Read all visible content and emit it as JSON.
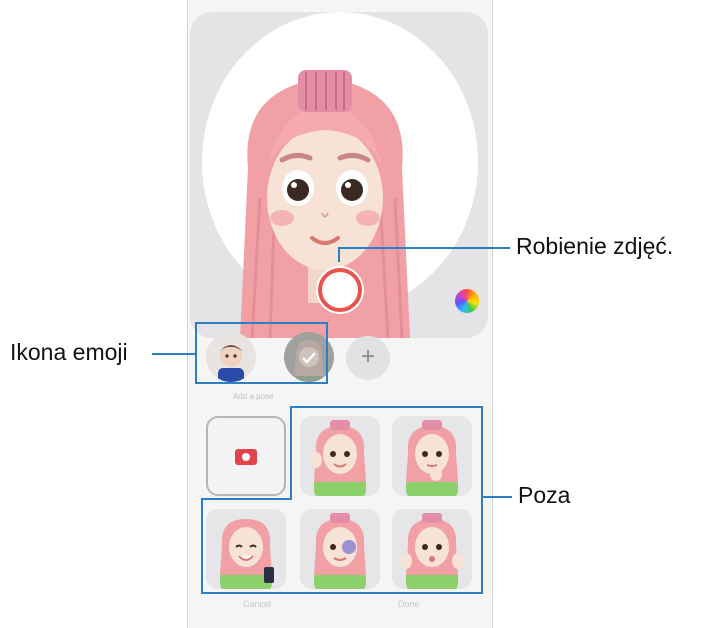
{
  "screen": {
    "emoji_section_label": "Add a pose",
    "add_emoji_label": "+",
    "cancel_label": "Cancel",
    "done_label": "Done"
  },
  "callouts": {
    "capture": "Robienie zdjęć.",
    "emoji_icon": "Ikona emoji",
    "pose": "Poza"
  },
  "colors": {
    "accent": "#2b7fc2",
    "shutter_ring": "#e8534d",
    "camera_icon": "#e2434a"
  }
}
